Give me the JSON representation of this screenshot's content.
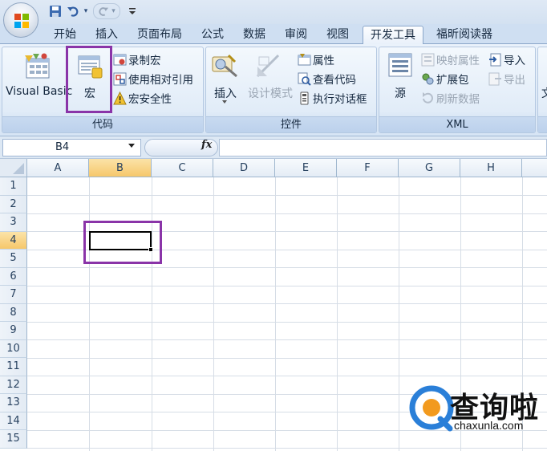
{
  "quick_access": {
    "customize_glyph": "▾"
  },
  "tabs": [
    {
      "label": "开始"
    },
    {
      "label": "插入"
    },
    {
      "label": "页面布局"
    },
    {
      "label": "公式"
    },
    {
      "label": "数据"
    },
    {
      "label": "审阅"
    },
    {
      "label": "视图"
    },
    {
      "label": "开发工具",
      "active": true
    },
    {
      "label": "福昕阅读器"
    }
  ],
  "ribbon": {
    "code_group": {
      "label": "代码",
      "visual_basic": "Visual Basic",
      "macro": "宏",
      "record_macro": "录制宏",
      "relative_ref": "使用相对引用",
      "macro_security": "宏安全性"
    },
    "controls_group": {
      "label": "控件",
      "insert": "插入",
      "design_mode": "设计模式",
      "properties": "属性",
      "view_code": "查看代码",
      "run_dialog": "执行对话框"
    },
    "xml_group": {
      "label": "XML",
      "source": "源",
      "map_properties": "映射属性",
      "expansion_packs": "扩展包",
      "refresh_data": "刷新数据",
      "import": "导入",
      "export": "导出"
    },
    "doc_group_partial": "文"
  },
  "formula_bar": {
    "name_box": "B4",
    "fx": "fx",
    "formula": ""
  },
  "grid": {
    "columns": [
      "A",
      "B",
      "C",
      "D",
      "E",
      "F",
      "G",
      "H"
    ],
    "rows": [
      "1",
      "2",
      "3",
      "4",
      "5",
      "6",
      "7",
      "8",
      "9",
      "10",
      "11",
      "12",
      "13",
      "14",
      "15"
    ],
    "selected_column": "B",
    "selected_row": "4"
  },
  "watermark": {
    "text": "查询啦",
    "url": "chaxunla.com"
  },
  "colors": {
    "highlight": "#8a34a8",
    "selected_header": "#f6c76b",
    "ribbon_bg": "#dbe7f5"
  }
}
